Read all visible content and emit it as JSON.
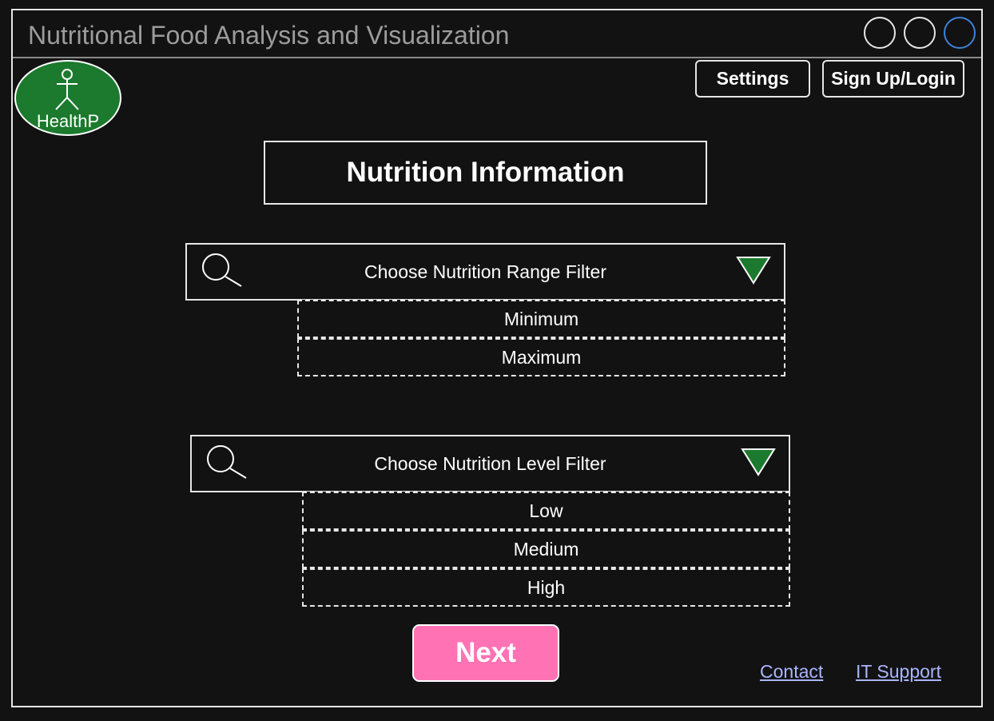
{
  "window": {
    "title": "Nutritional Food Analysis and Visualization",
    "controls": [
      "window-button",
      "window-button",
      "window-button"
    ]
  },
  "logo": {
    "text": "HealthP",
    "icon": "stick-figure-icon",
    "color": "#1b7a2d"
  },
  "header": {
    "settings_label": "Settings",
    "login_label": "Sign Up/Login"
  },
  "main": {
    "heading": "Nutrition Information",
    "range_filter": {
      "label": "Choose Nutrition Range Filter",
      "options": [
        "Minimum",
        "Maximum"
      ]
    },
    "level_filter": {
      "label": "Choose Nutrition Level Filter",
      "options": [
        "Low",
        "Medium",
        "High"
      ]
    },
    "next_label": "Next",
    "next_color": "#ff73b4",
    "dropdown_color": "#1b7a2d"
  },
  "footer": {
    "contact_label": "Contact",
    "support_label": "IT Support"
  }
}
